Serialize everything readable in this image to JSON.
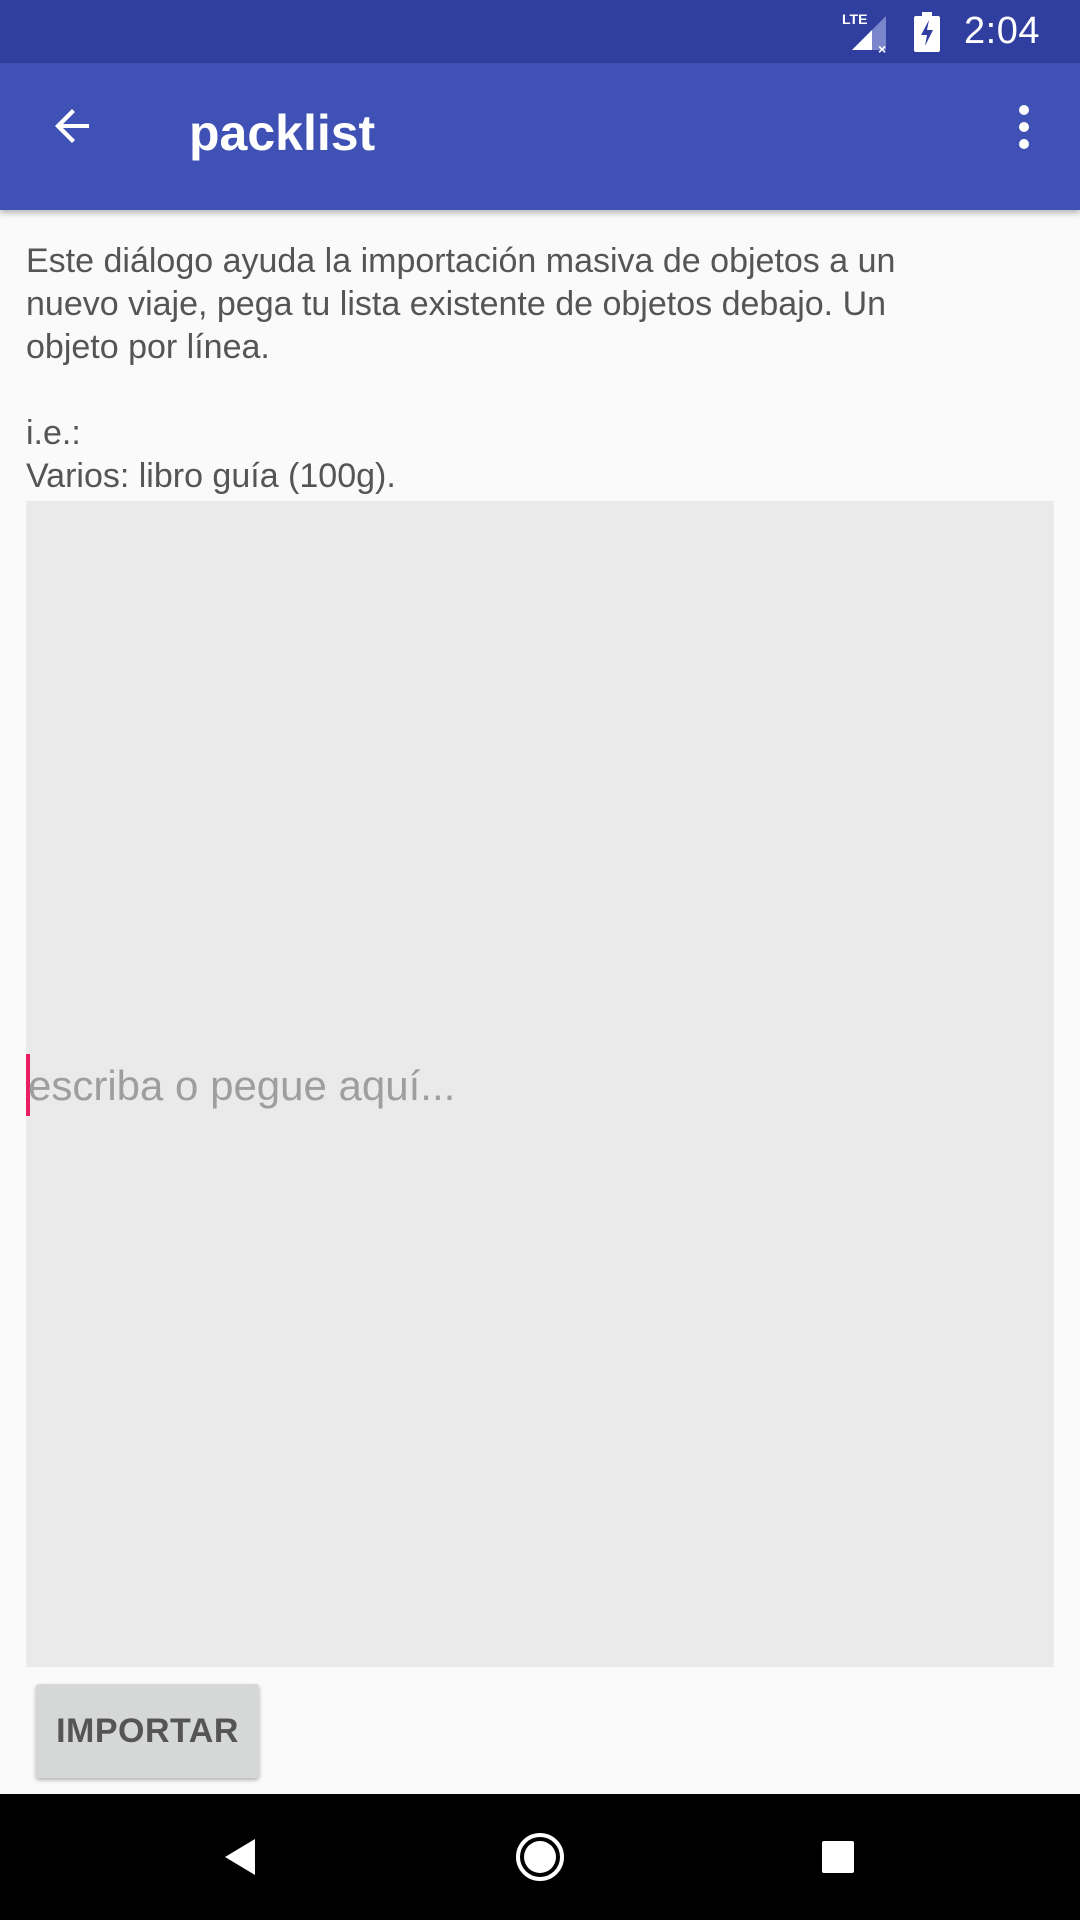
{
  "status_bar": {
    "network_label": "LTE",
    "time": "2:04"
  },
  "app_bar": {
    "title": "packlist",
    "back_icon": "arrow-left-icon",
    "menu_icon": "more-vert-icon"
  },
  "description": "Este diálogo ayuda la importación masiva de objetos a un\nnuevo viaje, pega tu lista existente de objetos debajo. Un\nobjeto por línea.\n\ni.e.:\nVarios: libro guía (100g).",
  "import_input": {
    "value": "",
    "placeholder": "escriba o pegue aquí..."
  },
  "import_button": {
    "label": "IMPORTAR"
  },
  "nav_bar": {
    "back_icon": "triangle-back-icon",
    "home_icon": "circle-home-icon",
    "recents_icon": "square-recents-icon"
  },
  "colors": {
    "status_bar": "#303f9f",
    "app_bar": "#3f51b5",
    "accent": "#e91e63"
  }
}
